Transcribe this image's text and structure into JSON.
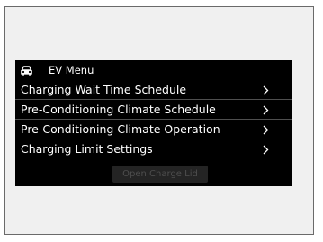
{
  "header": {
    "title": "EV Menu",
    "icon": "car-icon"
  },
  "menu": {
    "items": [
      {
        "label": "Charging Wait Time Schedule",
        "icon": "chevron-right-icon"
      },
      {
        "label": "Pre-Conditioning Climate Schedule",
        "icon": "chevron-right-icon"
      },
      {
        "label": "Pre-Conditioning Climate Operation",
        "icon": "chevron-right-icon"
      },
      {
        "label": "Charging Limit Settings",
        "icon": "chevron-right-icon"
      }
    ]
  },
  "footer": {
    "button_label": "Open Charge Lid",
    "button_state": "disabled"
  },
  "colors": {
    "screen_background": "#000000",
    "text": "#ffffff",
    "disabled_text": "#4e4e4e",
    "divider": "#4f4f4f"
  }
}
